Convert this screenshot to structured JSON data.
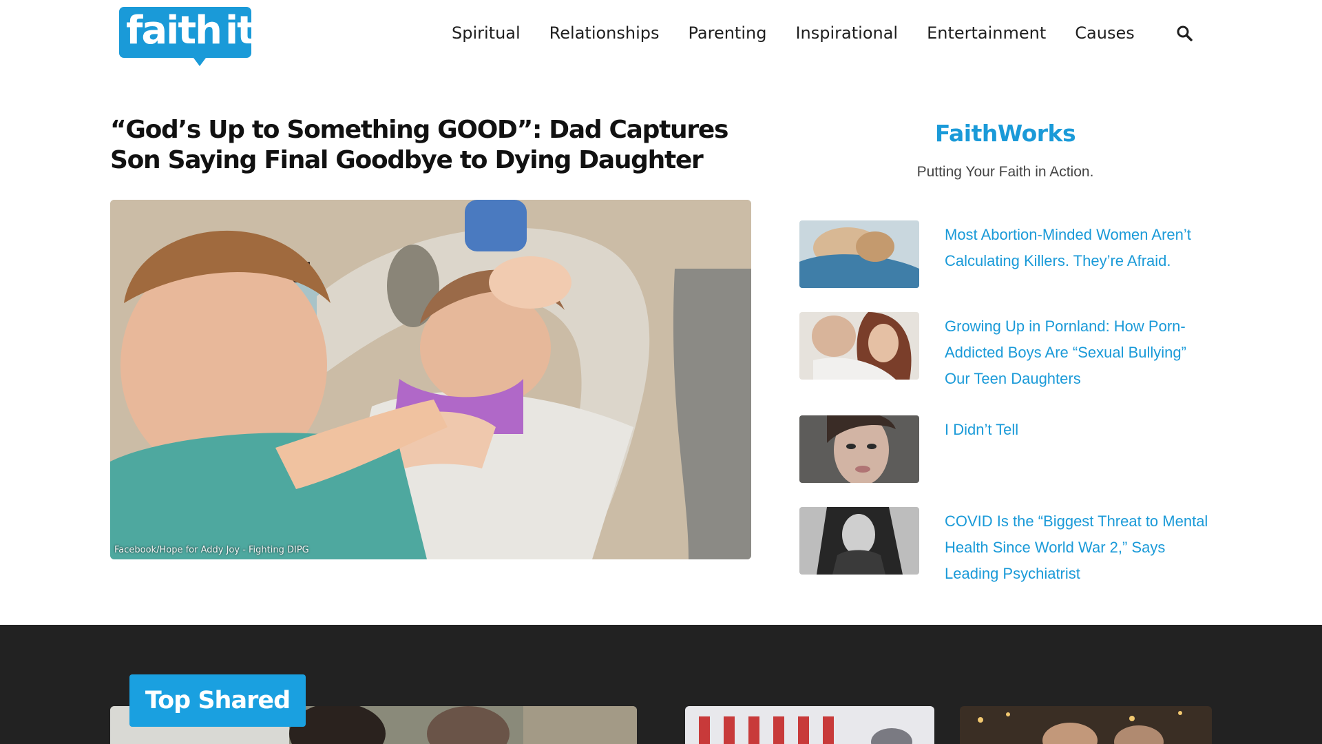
{
  "header": {
    "logo": {
      "text_main": "faith",
      "text_accent": "it"
    },
    "nav": [
      "Spiritual",
      "Relationships",
      "Parenting",
      "Inspirational",
      "Entertainment",
      "Causes"
    ],
    "search_icon": "search-icon"
  },
  "article": {
    "title": "“God’s Up to Something GOOD”: Dad Captures Son Saying Final Goodbye to Dying Daughter",
    "image_caption": "Facebook/Hope for Addy Joy - Fighting DIPG"
  },
  "sidebar": {
    "title": "FaithWorks",
    "subtitle": "Putting Your Faith in Action.",
    "items": [
      {
        "title": "Most Abortion-Minded Women Aren’t Calculating Killers. They’re Afraid."
      },
      {
        "title": "Growing Up in Pornland: How Porn-Addicted Boys Are “Sexual Bullying” Our Teen Daughters"
      },
      {
        "title": "I Didn’t Tell"
      },
      {
        "title": "COVID Is the “Biggest Threat to Mental Health Since World War 2,” Says Leading Psychiatrist"
      }
    ]
  },
  "top_shared": {
    "label": "Top Shared"
  },
  "colors": {
    "brand_blue": "#1a9ad8",
    "band_dark": "#222222",
    "badge_blue": "#1aa0e0"
  }
}
